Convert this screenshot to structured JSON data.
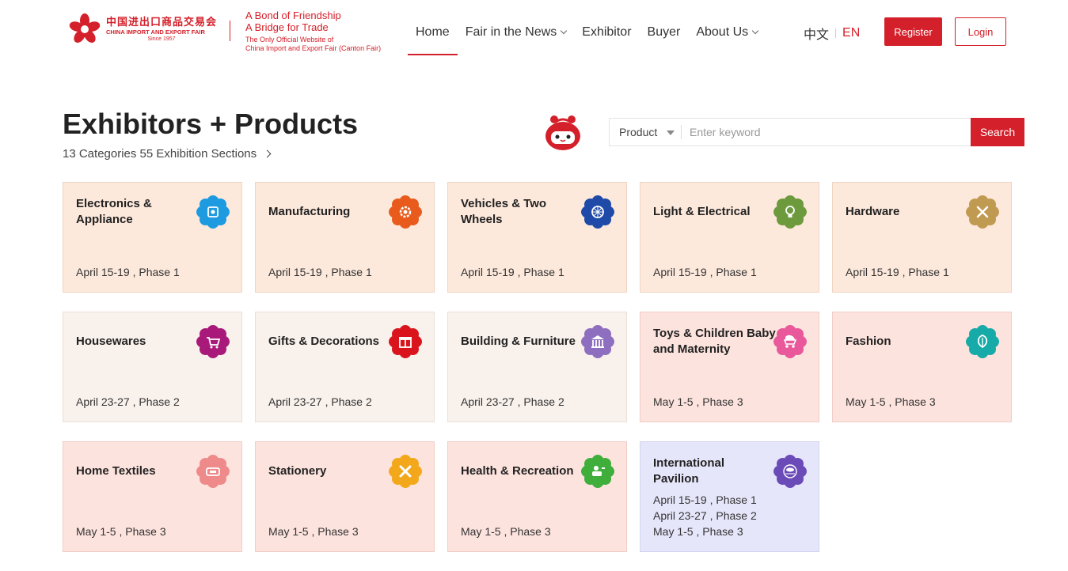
{
  "header": {
    "logo_cn": "中国进出口商品交易会",
    "logo_en": "CHINA IMPORT AND EXPORT FAIR",
    "logo_since": "Since 1957",
    "slogan_line1": "A Bond of Friendship",
    "slogan_line2": "A Bridge for Trade",
    "slogan_line3": "The Only Official Website of",
    "slogan_line4": "China Import and Export Fair (Canton Fair)",
    "nav": [
      {
        "label": "Home",
        "active": true
      },
      {
        "label": "Fair in the News",
        "dropdown": true
      },
      {
        "label": "Exhibitor"
      },
      {
        "label": "Buyer"
      },
      {
        "label": "About Us",
        "dropdown": true
      }
    ],
    "lang_cn": "中文",
    "lang_en": "EN",
    "register_label": "Register",
    "login_label": "Login",
    "accent": "#d4202a"
  },
  "title": "Exhibitors + Products",
  "subtitle": "13 Categories 55 Exhibition Sections",
  "search": {
    "type_value": "Product",
    "placeholder": "Enter keyword",
    "button_label": "Search"
  },
  "categories": [
    {
      "name": "Electronics & Appliance",
      "dates": [
        "April 15-19 , Phase 1"
      ],
      "icon": "circuit-chip-icon",
      "icon_color": "#1e9be0"
    },
    {
      "name": "Manufacturing",
      "dates": [
        "April 15-19 , Phase 1"
      ],
      "icon": "gear-icon",
      "icon_color": "#e85b1c"
    },
    {
      "name": "Vehicles & Two Wheels",
      "dates": [
        "April 15-19 , Phase 1"
      ],
      "icon": "wheel-icon",
      "icon_color": "#1f4aa8"
    },
    {
      "name": "Light & Electrical",
      "dates": [
        "April 15-19 , Phase 1"
      ],
      "icon": "light-bulb-icon",
      "icon_color": "#6c9a3c"
    },
    {
      "name": "Hardware",
      "dates": [
        "April 15-19 , Phase 1"
      ],
      "icon": "tools-icon",
      "icon_color": "#c19a52"
    },
    {
      "name": "Housewares",
      "dates": [
        "April 23-27 , Phase 2"
      ],
      "icon": "shopping-cart-icon",
      "icon_color": "#a8197a"
    },
    {
      "name": "Gifts & Decorations",
      "dates": [
        "April 23-27 , Phase 2"
      ],
      "icon": "gift-box-icon",
      "icon_color": "#d9141d"
    },
    {
      "name": "Building & Furniture",
      "dates": [
        "April 23-27 , Phase 2"
      ],
      "icon": "building-icon",
      "icon_color": "#8e6fbf"
    },
    {
      "name": "Toys & Children Baby and Maternity",
      "dates": [
        "May 1-5 , Phase 3"
      ],
      "icon": "stroller-icon",
      "icon_color": "#e8589a"
    },
    {
      "name": "Fashion",
      "dates": [
        "May 1-5 , Phase 3"
      ],
      "icon": "leaf-icon",
      "icon_color": "#16aaa8"
    },
    {
      "name": "Home Textiles",
      "dates": [
        "May 1-5 , Phase 3"
      ],
      "icon": "sewing-machine-icon",
      "icon_color": "#ee8a8a"
    },
    {
      "name": "Stationery",
      "dates": [
        "May 1-5 , Phase 3"
      ],
      "icon": "pencil-ruler-icon",
      "icon_color": "#f2a81a"
    },
    {
      "name": "Health & Recreation",
      "dates": [
        "May 1-5 , Phase 3"
      ],
      "icon": "fitness-icon",
      "icon_color": "#3fae3a"
    },
    {
      "name": "International Pavilion",
      "dates": [
        "April 15-19 , Phase 1",
        "April 23-27 , Phase 2",
        "May 1-5 , Phase 3"
      ],
      "icon": "globe-pavilion-icon",
      "icon_color": "#6b4bb8"
    }
  ]
}
